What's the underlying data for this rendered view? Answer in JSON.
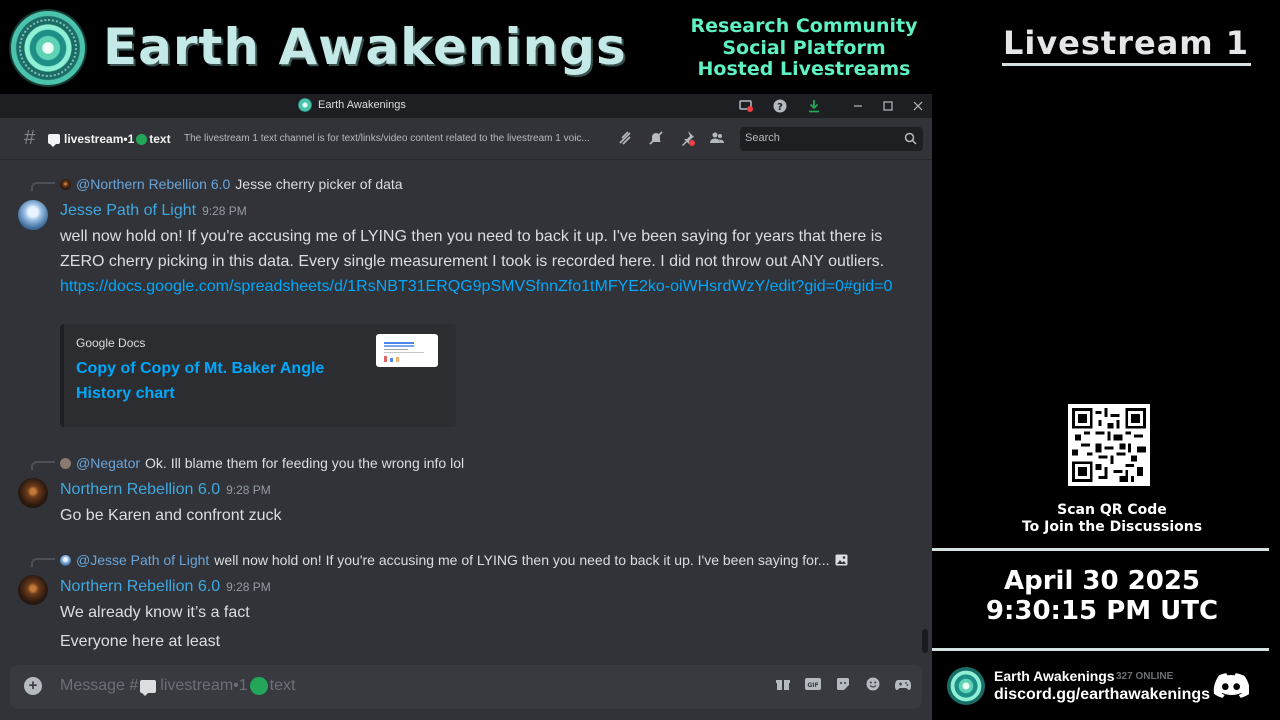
{
  "banner": {
    "brand_title": "Earth Awakenings",
    "taglines": [
      "Research Community",
      "Social Platform",
      "Hosted Livestreams"
    ],
    "colors": {
      "title": "#c4e9e7",
      "tagline": "#5ff0c4"
    }
  },
  "panel": {
    "stream_title": "Livestream 1",
    "qr_caption": [
      "Scan QR Code",
      "To Join the Discussions"
    ],
    "date": "April 30 2025",
    "time": "9:30:15 PM UTC",
    "footer": {
      "server_name": "Earth Awakenings",
      "online": "327 ONLINE",
      "invite": "discord.gg/earthawakenings"
    }
  },
  "window": {
    "title": "Earth Awakenings",
    "icons": [
      "screen-share-icon",
      "help-icon",
      "download-icon",
      "minimize-icon",
      "maximize-icon",
      "close-icon"
    ]
  },
  "channel": {
    "name_prefix": "livestream•1",
    "name_suffix": "text",
    "topic": "The livestream 1 text channel is for text/links/video content related to the livestream 1 voic...",
    "search_placeholder": "Search"
  },
  "messages": [
    {
      "reply_to": "@Northern Rebellion 6.0",
      "reply_text": "Jesse cherry picker of data",
      "author": "Jesse Path of Light",
      "time": "9:28 PM",
      "text": "well now hold on! If you're accusing me of LYING then you need to back it up. I've been saying for years that there is ZERO cherry picking in this data. Every single measurement I took is recorded here. I did not throw out ANY outliers. ",
      "link": "https://docs.google.com/spreadsheets/d/1RsNBT31ERQG9pSMVSfnnZfo1tMFYE2ko-oiWHsrdWzY/edit?gid=0#gid=0",
      "embed": {
        "provider": "Google Docs",
        "title": "Copy of Copy of Mt. Baker Angle History chart"
      }
    },
    {
      "reply_to": "@Negator",
      "reply_text": "Ok.  Ill blame them for feeding you the wrong info lol",
      "author": "Northern Rebellion 6.0",
      "time": "9:28 PM",
      "text": "Go be Karen and confront zuck"
    },
    {
      "reply_to": "@Jesse Path of Light",
      "reply_text": "well now hold on! If you're accusing me of LYING then you need to back it up. I've been saying for...",
      "author": "Northern Rebellion 6.0",
      "time": "9:28 PM",
      "text": "We already know it’s a fact",
      "text2": "Everyone here at least"
    }
  ],
  "composer": {
    "placeholder_prefix": "Message #",
    "placeholder_channel": "livestream•1",
    "placeholder_suffix": "text"
  }
}
